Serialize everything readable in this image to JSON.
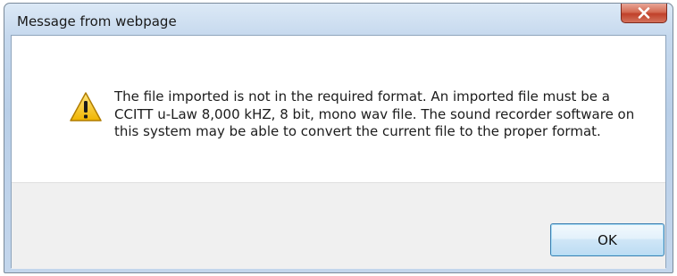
{
  "dialog": {
    "title": "Message from webpage",
    "message": "The file imported is not in the required format. An imported file must be a CCITT u-Law 8,000 kHZ, 8 bit, mono wav file. The sound recorder software on this system may be able to convert the current file to the proper format.",
    "icon": "warning-icon",
    "ok_label": "OK",
    "close_icon": "close-icon"
  },
  "colors": {
    "close_button": "#c0412a",
    "ok_border": "#3c7fb1",
    "warning_fill": "#f5c422"
  }
}
